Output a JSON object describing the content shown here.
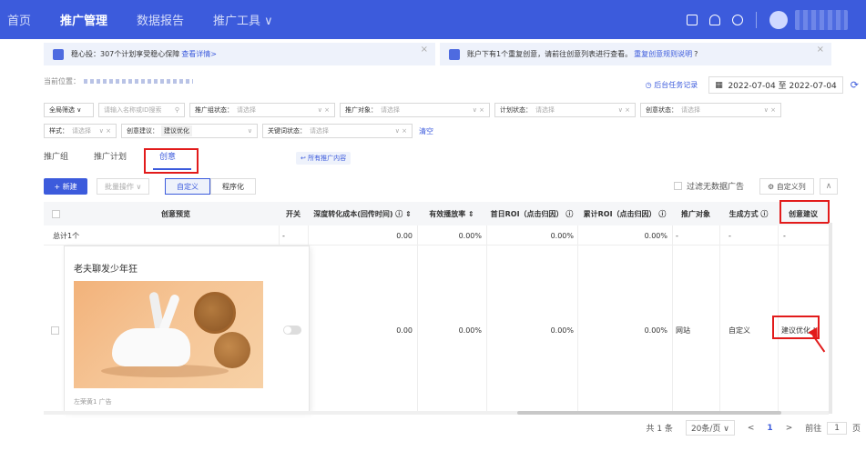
{
  "topbar": {
    "nav": [
      "首页",
      "推广管理",
      "数据报告",
      "推广工具 ∨"
    ]
  },
  "notices": [
    {
      "text": "稳心投：307个计划享受稳心保障",
      "link": "查看详情>"
    },
    {
      "text": "账户下有1个重复创意，请前往创意列表进行查看。",
      "link": "重复创意规则说明"
    }
  ],
  "breadcrumb": {
    "label": "当前位置："
  },
  "daterange": {
    "tasks": "后台任务记录",
    "range": "2022-07-04 至 2022-07-04"
  },
  "filters": {
    "all": "全局筛选 ∨",
    "search_ph": "请输入名称或ID搜索",
    "group_status": "推广组状态：",
    "placeholder": "请选择",
    "target": "推广对象：",
    "plan_status": "计划状态：",
    "creative_status": "创意状态：",
    "style": "样式：",
    "suggest": "创意建议：",
    "suggest_tag": "建议优化",
    "kw_status": "关键词状态：",
    "clear": "清空"
  },
  "tabs": [
    "推广组",
    "推广计划",
    "创意"
  ],
  "all_link": "↩ 所有推广内容",
  "toolbar": {
    "new": "+ 新建",
    "batch": "批量操作 ∨",
    "seg": [
      "自定义",
      "程序化"
    ],
    "filter_empty": "过滤无数据广告",
    "custom_cols": "⚙ 自定义列",
    "collapse": "∧"
  },
  "table": {
    "headers": [
      "创意预览",
      "开关",
      "深度转化成本(回传时间) ⓘ ⇕",
      "有效播放率 ⇕",
      "首日ROI（点击归因） ⓘ",
      "累计ROI（点击归因） ⓘ",
      "推广对象",
      "生成方式 ⓘ",
      "创意建议"
    ],
    "summary": {
      "label": "总计1个",
      "switch": "-",
      "cost": "0.00",
      "play": "0.00%",
      "roi1": "0.00%",
      "roi2": "0.00%",
      "obj": "-",
      "gen": "-",
      "sugg": "-"
    },
    "row": {
      "title": "老夫聊发少年狂",
      "meta": "左荣黄1 广告",
      "cost": "0.00",
      "play": "0.00%",
      "roi1": "0.00%",
      "roi2": "0.00%",
      "obj": "网站",
      "gen": "自定义",
      "sugg": "建议优化 !"
    }
  },
  "pager": {
    "total": "共 1 条",
    "size": "20条/页 ∨",
    "prev": "<",
    "page": "1",
    "next": ">",
    "goto": "前往",
    "goto_val": "1",
    "unit": "页"
  }
}
